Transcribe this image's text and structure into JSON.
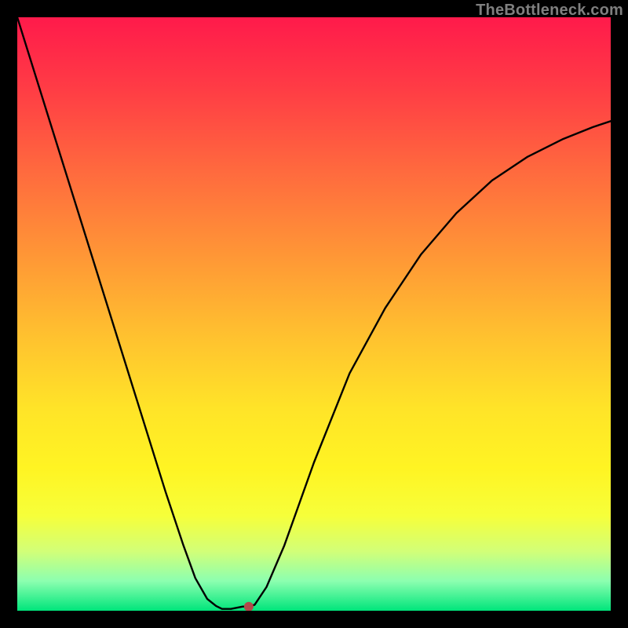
{
  "watermark": "TheBottleneck.com",
  "chart_data": {
    "type": "line",
    "title": "",
    "xlabel": "",
    "ylabel": "",
    "xlim": [
      0,
      1
    ],
    "ylim": [
      0,
      1
    ],
    "legend": false,
    "grid": false,
    "background": "red-yellow-green vertical gradient",
    "series": [
      {
        "name": "bottleneck-curve",
        "color": "#000000",
        "x": [
          0.0,
          0.05,
          0.1,
          0.15,
          0.2,
          0.25,
          0.28,
          0.3,
          0.32,
          0.335,
          0.345,
          0.36,
          0.38,
          0.39,
          0.4,
          0.42,
          0.45,
          0.5,
          0.56,
          0.62,
          0.68,
          0.74,
          0.8,
          0.86,
          0.92,
          0.97,
          1.0
        ],
        "y": [
          1.0,
          0.84,
          0.68,
          0.52,
          0.36,
          0.2,
          0.11,
          0.055,
          0.02,
          0.008,
          0.003,
          0.003,
          0.007,
          0.007,
          0.01,
          0.04,
          0.11,
          0.25,
          0.4,
          0.51,
          0.6,
          0.67,
          0.725,
          0.765,
          0.795,
          0.815,
          0.825
        ]
      }
    ],
    "marker": {
      "x": 0.39,
      "y": 0.007,
      "color": "#b24a4a",
      "r": 6
    }
  }
}
